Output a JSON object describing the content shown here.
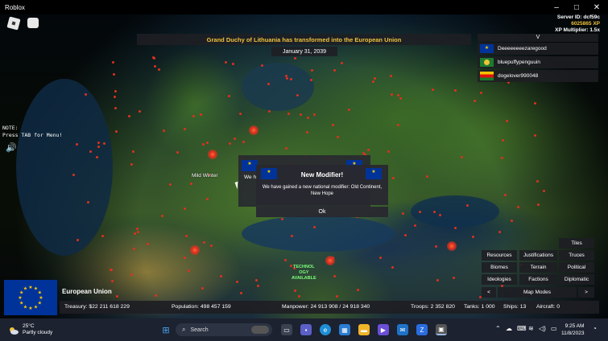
{
  "window": {
    "title": "Roblox",
    "minimize": "–",
    "maximize": "□",
    "close": "✕"
  },
  "server": {
    "id": "Server ID: dcf59c",
    "xp": "6025865 XP",
    "multiplier": "XP Multiplier: 1.5x"
  },
  "note": "NOTE:\nPress TAB for Menu!",
  "banner": "Grand Duchy of Lithuania has transformed into the European Union",
  "date": "January 31, 2039",
  "player_list": {
    "toggle": "V",
    "players": [
      {
        "name": "Deeeeeeeezaregood",
        "flag": "eu"
      },
      {
        "name": "bluepuffypenguuin",
        "flag": "green"
      },
      {
        "name": "dogelover990048",
        "flag": "tri"
      }
    ]
  },
  "map_labels": {
    "mild_winter": "Mild Winter",
    "tech": "TECHNOLOGY AVAILABLE"
  },
  "tech_lines": [
    "TECHNOL",
    "OGY",
    "AVAILABLE"
  ],
  "modal": {
    "behind_text": "We h",
    "title": "New Modifier!",
    "text": "We have gained a new national modifier: Old Continent, New Hope",
    "ok": "Ok"
  },
  "map_modes": {
    "tiles": "Tiles",
    "resources": "Resources",
    "justifications": "Justifications",
    "truces": "Truces",
    "biomes": "Biomes",
    "terrain": "Terrain",
    "political": "Political",
    "ideologies": "Ideologies",
    "factions": "Factions",
    "diplomatic": "Diplomatic",
    "prev": "<",
    "label": "Map Modes",
    "next": ">"
  },
  "country": {
    "name": "European Union",
    "treasury": "Treasury:  $22 211 618 229",
    "population": "Population: 498 457 159",
    "manpower": "Manpower:  24 913 908  /  24 918 340",
    "troops": "Troops: 2 352 820",
    "tanks": "Tanks: 1 000",
    "ships": "Ships: 13",
    "aircraft": "Aircraft: 0"
  },
  "taskbar": {
    "temperature": "25°C",
    "weather": "Partly cloudy",
    "search": "Search",
    "time": "9:25 AM",
    "date": "11/8/2023"
  },
  "colors": {
    "accent": "#f0c23a",
    "eu_blue": "#003399",
    "eu_star": "#ffcc00",
    "province_red": "#e0301e"
  }
}
